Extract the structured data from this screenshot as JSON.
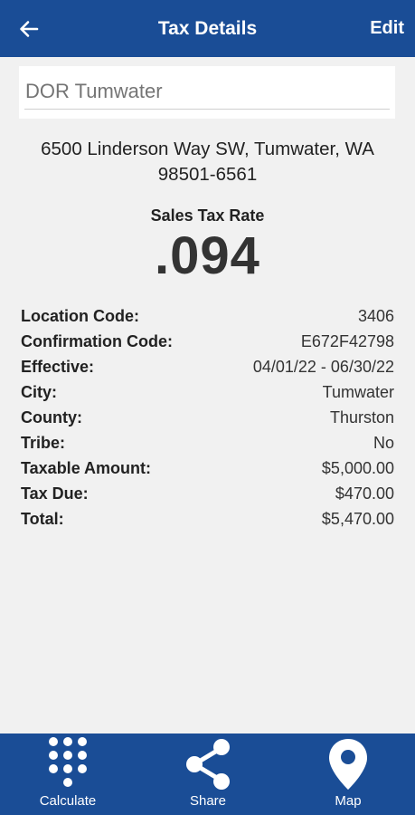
{
  "header": {
    "title": "Tax Details",
    "edit_label": "Edit"
  },
  "location": {
    "name_placeholder": "DOR Tumwater",
    "address_line1": "6500 Linderson Way SW, Tumwater, WA",
    "address_line2": "98501-6561"
  },
  "rate": {
    "label": "Sales Tax Rate",
    "value": ".094"
  },
  "details": [
    {
      "label": "Location Code:",
      "value": "3406"
    },
    {
      "label": "Confirmation Code:",
      "value": "E672F42798"
    },
    {
      "label": "Effective:",
      "value": "04/01/22 - 06/30/22"
    },
    {
      "label": "City:",
      "value": "Tumwater"
    },
    {
      "label": "County:",
      "value": "Thurston"
    },
    {
      "label": "Tribe:",
      "value": "No"
    },
    {
      "label": "Taxable Amount:",
      "value": "$5,000.00"
    },
    {
      "label": "Tax Due:",
      "value": "$470.00"
    },
    {
      "label": "Total:",
      "value": "$5,470.00"
    }
  ],
  "bottom_nav": [
    {
      "label": "Calculate",
      "icon": "keypad-icon"
    },
    {
      "label": "Share",
      "icon": "share-icon"
    },
    {
      "label": "Map",
      "icon": "map-pin-icon"
    }
  ],
  "colors": {
    "bar_blue": "#1a4d96",
    "background": "#f1f1f1"
  }
}
